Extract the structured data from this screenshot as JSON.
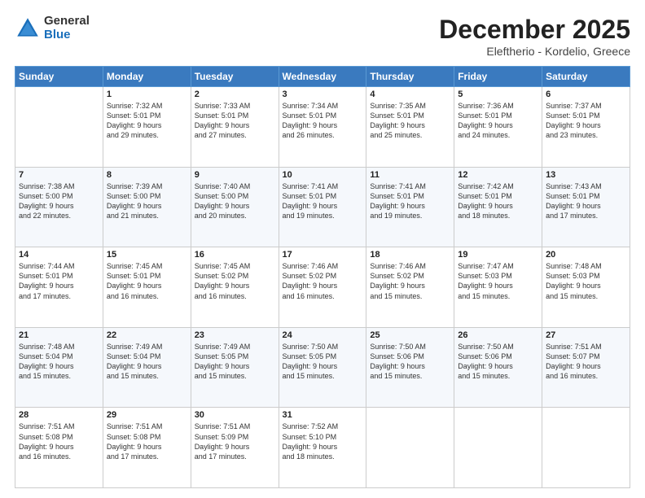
{
  "logo": {
    "general": "General",
    "blue": "Blue"
  },
  "header": {
    "title": "December 2025",
    "subtitle": "Eleftherio - Kordelio, Greece"
  },
  "weekdays": [
    "Sunday",
    "Monday",
    "Tuesday",
    "Wednesday",
    "Thursday",
    "Friday",
    "Saturday"
  ],
  "weeks": [
    [
      {
        "day": "",
        "info": ""
      },
      {
        "day": "1",
        "info": "Sunrise: 7:32 AM\nSunset: 5:01 PM\nDaylight: 9 hours\nand 29 minutes."
      },
      {
        "day": "2",
        "info": "Sunrise: 7:33 AM\nSunset: 5:01 PM\nDaylight: 9 hours\nand 27 minutes."
      },
      {
        "day": "3",
        "info": "Sunrise: 7:34 AM\nSunset: 5:01 PM\nDaylight: 9 hours\nand 26 minutes."
      },
      {
        "day": "4",
        "info": "Sunrise: 7:35 AM\nSunset: 5:01 PM\nDaylight: 9 hours\nand 25 minutes."
      },
      {
        "day": "5",
        "info": "Sunrise: 7:36 AM\nSunset: 5:01 PM\nDaylight: 9 hours\nand 24 minutes."
      },
      {
        "day": "6",
        "info": "Sunrise: 7:37 AM\nSunset: 5:01 PM\nDaylight: 9 hours\nand 23 minutes."
      }
    ],
    [
      {
        "day": "7",
        "info": "Sunrise: 7:38 AM\nSunset: 5:00 PM\nDaylight: 9 hours\nand 22 minutes."
      },
      {
        "day": "8",
        "info": "Sunrise: 7:39 AM\nSunset: 5:00 PM\nDaylight: 9 hours\nand 21 minutes."
      },
      {
        "day": "9",
        "info": "Sunrise: 7:40 AM\nSunset: 5:00 PM\nDaylight: 9 hours\nand 20 minutes."
      },
      {
        "day": "10",
        "info": "Sunrise: 7:41 AM\nSunset: 5:01 PM\nDaylight: 9 hours\nand 19 minutes."
      },
      {
        "day": "11",
        "info": "Sunrise: 7:41 AM\nSunset: 5:01 PM\nDaylight: 9 hours\nand 19 minutes."
      },
      {
        "day": "12",
        "info": "Sunrise: 7:42 AM\nSunset: 5:01 PM\nDaylight: 9 hours\nand 18 minutes."
      },
      {
        "day": "13",
        "info": "Sunrise: 7:43 AM\nSunset: 5:01 PM\nDaylight: 9 hours\nand 17 minutes."
      }
    ],
    [
      {
        "day": "14",
        "info": "Sunrise: 7:44 AM\nSunset: 5:01 PM\nDaylight: 9 hours\nand 17 minutes."
      },
      {
        "day": "15",
        "info": "Sunrise: 7:45 AM\nSunset: 5:01 PM\nDaylight: 9 hours\nand 16 minutes."
      },
      {
        "day": "16",
        "info": "Sunrise: 7:45 AM\nSunset: 5:02 PM\nDaylight: 9 hours\nand 16 minutes."
      },
      {
        "day": "17",
        "info": "Sunrise: 7:46 AM\nSunset: 5:02 PM\nDaylight: 9 hours\nand 16 minutes."
      },
      {
        "day": "18",
        "info": "Sunrise: 7:46 AM\nSunset: 5:02 PM\nDaylight: 9 hours\nand 15 minutes."
      },
      {
        "day": "19",
        "info": "Sunrise: 7:47 AM\nSunset: 5:03 PM\nDaylight: 9 hours\nand 15 minutes."
      },
      {
        "day": "20",
        "info": "Sunrise: 7:48 AM\nSunset: 5:03 PM\nDaylight: 9 hours\nand 15 minutes."
      }
    ],
    [
      {
        "day": "21",
        "info": "Sunrise: 7:48 AM\nSunset: 5:04 PM\nDaylight: 9 hours\nand 15 minutes."
      },
      {
        "day": "22",
        "info": "Sunrise: 7:49 AM\nSunset: 5:04 PM\nDaylight: 9 hours\nand 15 minutes."
      },
      {
        "day": "23",
        "info": "Sunrise: 7:49 AM\nSunset: 5:05 PM\nDaylight: 9 hours\nand 15 minutes."
      },
      {
        "day": "24",
        "info": "Sunrise: 7:50 AM\nSunset: 5:05 PM\nDaylight: 9 hours\nand 15 minutes."
      },
      {
        "day": "25",
        "info": "Sunrise: 7:50 AM\nSunset: 5:06 PM\nDaylight: 9 hours\nand 15 minutes."
      },
      {
        "day": "26",
        "info": "Sunrise: 7:50 AM\nSunset: 5:06 PM\nDaylight: 9 hours\nand 15 minutes."
      },
      {
        "day": "27",
        "info": "Sunrise: 7:51 AM\nSunset: 5:07 PM\nDaylight: 9 hours\nand 16 minutes."
      }
    ],
    [
      {
        "day": "28",
        "info": "Sunrise: 7:51 AM\nSunset: 5:08 PM\nDaylight: 9 hours\nand 16 minutes."
      },
      {
        "day": "29",
        "info": "Sunrise: 7:51 AM\nSunset: 5:08 PM\nDaylight: 9 hours\nand 17 minutes."
      },
      {
        "day": "30",
        "info": "Sunrise: 7:51 AM\nSunset: 5:09 PM\nDaylight: 9 hours\nand 17 minutes."
      },
      {
        "day": "31",
        "info": "Sunrise: 7:52 AM\nSunset: 5:10 PM\nDaylight: 9 hours\nand 18 minutes."
      },
      {
        "day": "",
        "info": ""
      },
      {
        "day": "",
        "info": ""
      },
      {
        "day": "",
        "info": ""
      }
    ]
  ]
}
